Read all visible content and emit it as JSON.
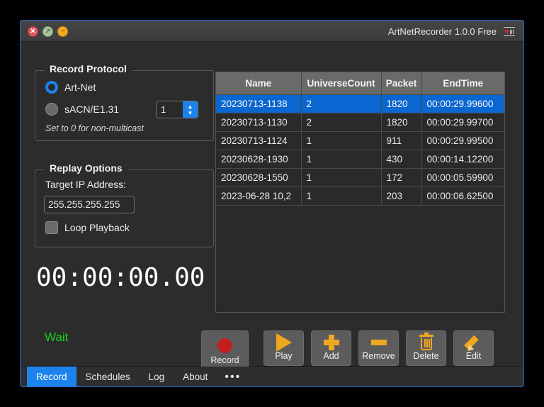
{
  "window": {
    "title": "ArtNetRecorder 1.0.0 Free",
    "app_icon": "record-camera-icon",
    "controls": {
      "close": "✕",
      "maximize": "↗",
      "minimize": "−"
    }
  },
  "record_protocol": {
    "group_label": "Record Protocol",
    "options": [
      {
        "label": "Art-Net",
        "selected": true
      },
      {
        "label": "sACN/E1.31",
        "selected": false
      }
    ],
    "spinner_value": "1",
    "spinner_up": "▲",
    "spinner_down": "▼",
    "hint": "Set to 0 for non-multicast"
  },
  "replay_options": {
    "group_label": "Replay Options",
    "target_ip_label": "Target IP Address:",
    "target_ip_value": "255.255.255.255",
    "target_ip_placeholder": "255.255.255.255",
    "loop_label": "Loop Playback",
    "loop_checked": false
  },
  "timecode": "00:00:00.00",
  "status": {
    "text": "Wait",
    "color": "#18d318"
  },
  "table": {
    "columns": [
      "Name",
      "UniverseCount",
      "Packet",
      "EndTime"
    ],
    "rows": [
      {
        "name": "20230713-1138",
        "universe_count": "2",
        "packet": "1820",
        "end_time": "00:00:29.99600",
        "selected": true
      },
      {
        "name": "20230713-1130",
        "universe_count": "2",
        "packet": "1820",
        "end_time": "00:00:29.99700",
        "selected": false
      },
      {
        "name": "20230713-1124",
        "universe_count": "1",
        "packet": "911",
        "end_time": "00:00:29.99500",
        "selected": false
      },
      {
        "name": "20230628-1930",
        "universe_count": "1",
        "packet": "430",
        "end_time": "00:00:14.12200",
        "selected": false
      },
      {
        "name": "20230628-1550",
        "universe_count": "1",
        "packet": "172",
        "end_time": "00:00:05.59900",
        "selected": false
      },
      {
        "name": "2023-06-28 10,2",
        "universe_count": "1",
        "packet": "203",
        "end_time": "00:00:06.62500",
        "selected": false
      }
    ],
    "selection_color": "#0a66d0"
  },
  "toolbar": {
    "buttons": [
      {
        "label": "Record",
        "icon": "record-dot-icon"
      },
      {
        "label": "Play",
        "icon": "play-triangle-icon"
      },
      {
        "label": "Add",
        "icon": "plus-icon"
      },
      {
        "label": "Remove",
        "icon": "minus-icon"
      },
      {
        "label": "Delete",
        "icon": "trash-icon"
      },
      {
        "label": "Edit",
        "icon": "pencil-icon"
      }
    ],
    "accent_color": "#f0a81e",
    "record_color": "#c41f1f"
  },
  "tabs": [
    {
      "label": "Record",
      "active": true
    },
    {
      "label": "Schedules",
      "active": false
    },
    {
      "label": "Log",
      "active": false
    },
    {
      "label": "About",
      "active": false
    },
    {
      "label": "•••",
      "active": false,
      "more": true
    }
  ],
  "cursor": {
    "type": "pointing-hand"
  }
}
